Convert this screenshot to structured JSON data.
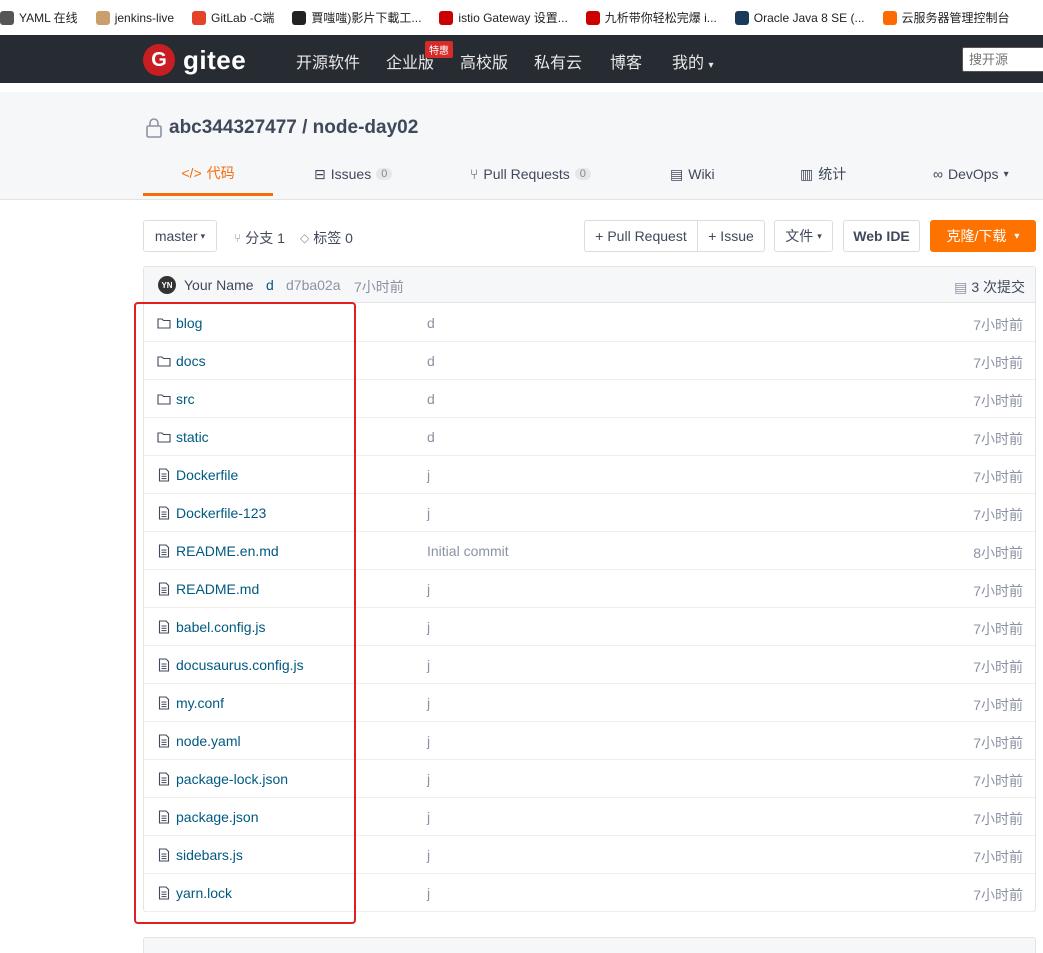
{
  "bookmarks": [
    {
      "label": "YAML 在线",
      "color": "#555"
    },
    {
      "label": "jenkins-live",
      "color": "#c9a06b"
    },
    {
      "label": "GitLab -C端",
      "color": "#e24329"
    },
    {
      "label": "賈嗤嗤)影片下載工...",
      "color": "#222"
    },
    {
      "label": "istio Gateway 设置...",
      "color": "#c00"
    },
    {
      "label": "九析带你轻松完爆 i...",
      "color": "#c00"
    },
    {
      "label": "Oracle Java 8 SE (...",
      "color": "#1a3a5a"
    },
    {
      "label": "云服务器管理控制台",
      "color": "#ff6a00"
    }
  ],
  "nav": {
    "logo_text": "gitee",
    "items": [
      "开源软件",
      "企业版",
      "高校版",
      "私有云",
      "博客",
      "我的"
    ],
    "hot_badge": "特惠",
    "search_placeholder": "搜开源"
  },
  "project": {
    "owner_repo": "abc344327477 / node-day02"
  },
  "tabs": [
    {
      "label": "代码",
      "icon": "code-icon",
      "active": true
    },
    {
      "label": "Issues",
      "count": "0",
      "icon": "issue-icon"
    },
    {
      "label": "Pull Requests",
      "count": "0",
      "icon": "pr-icon"
    },
    {
      "label": "Wiki",
      "icon": "wiki-icon"
    },
    {
      "label": "统计",
      "icon": "chart-icon"
    },
    {
      "label": "DevOps",
      "icon": "devops-icon"
    }
  ],
  "toolbar": {
    "branch": "master",
    "branches": "分支 1",
    "tags": "标签 0",
    "pull_request": "+ Pull Request",
    "issue": "+ Issue",
    "file": "文件",
    "web_ide": "Web IDE",
    "clone": "克隆/下载",
    "accent": "#fe7300"
  },
  "commit": {
    "avatar": "YN",
    "author": "Your Name",
    "message": "d",
    "hash": "d7ba02a",
    "time": "7小时前",
    "total": "3 次提交"
  },
  "files": [
    {
      "name": "blog",
      "type": "folder",
      "message": "d",
      "time": "7小时前"
    },
    {
      "name": "docs",
      "type": "folder",
      "message": "d",
      "time": "7小时前"
    },
    {
      "name": "src",
      "type": "folder",
      "message": "d",
      "time": "7小时前"
    },
    {
      "name": "static",
      "type": "folder",
      "message": "d",
      "time": "7小时前"
    },
    {
      "name": "Dockerfile",
      "type": "file",
      "message": "j",
      "time": "7小时前"
    },
    {
      "name": "Dockerfile-123",
      "type": "file",
      "message": "j",
      "time": "7小时前"
    },
    {
      "name": "README.en.md",
      "type": "file",
      "message": "Initial commit",
      "time": "8小时前"
    },
    {
      "name": "README.md",
      "type": "file",
      "message": "j",
      "time": "7小时前"
    },
    {
      "name": "babel.config.js",
      "type": "file",
      "message": "j",
      "time": "7小时前"
    },
    {
      "name": "docusaurus.config.js",
      "type": "file",
      "message": "j",
      "time": "7小时前"
    },
    {
      "name": "my.conf",
      "type": "file",
      "message": "j",
      "time": "7小时前"
    },
    {
      "name": "node.yaml",
      "type": "file",
      "message": "j",
      "time": "7小时前"
    },
    {
      "name": "package-lock.json",
      "type": "file",
      "message": "j",
      "time": "7小时前"
    },
    {
      "name": "package.json",
      "type": "file",
      "message": "j",
      "time": "7小时前"
    },
    {
      "name": "sidebars.js",
      "type": "file",
      "message": "j",
      "time": "7小时前"
    },
    {
      "name": "yarn.lock",
      "type": "file",
      "message": "j",
      "time": "7小时前"
    }
  ]
}
